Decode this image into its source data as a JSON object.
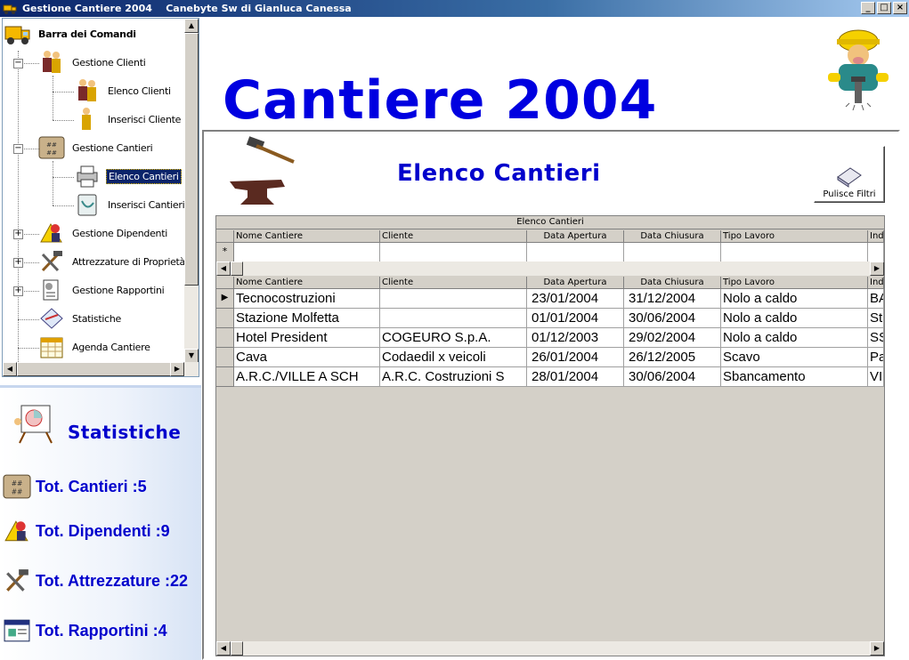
{
  "window": {
    "title": "Gestione Cantiere 2004    Canebyte Sw di Gianluca Canessa",
    "buttons": [
      "_",
      "□",
      "×"
    ]
  },
  "tree": {
    "root": "Barra dei Comandi",
    "items": [
      {
        "label": "Gestione Clienti",
        "expander": "−"
      },
      {
        "label": "Elenco Clienti"
      },
      {
        "label": "Inserisci Cliente"
      },
      {
        "label": "Gestione Cantieri",
        "expander": "−"
      },
      {
        "label": "Elenco Cantieri"
      },
      {
        "label": "Inserisci Cantieri"
      },
      {
        "label": "Gestione Dipendenti",
        "expander": "+"
      },
      {
        "label": "Attrezzature di Proprietà",
        "expander": "+"
      },
      {
        "label": "Gestione Rapportini",
        "expander": "+"
      },
      {
        "label": "Statistiche"
      },
      {
        "label": "Agenda Cantiere"
      }
    ]
  },
  "stats": {
    "title": "Statistiche",
    "cantieri": "Tot. Cantieri :5",
    "dipendenti": "Tot. Dipendenti :9",
    "attrezzature": "Tot. Attrezzature :22",
    "rapportini": "Tot. Rapportini :4"
  },
  "main": {
    "header": "Cantiere 2004",
    "form_title": "Elenco Cantieri",
    "clear_button": "Pulisce Filtri"
  },
  "grid": {
    "caption": "Elenco Cantieri",
    "columns": [
      "Nome Cantiere",
      "Cliente",
      "Data Apertura",
      "Data Chiusura",
      "Tipo Lavoro",
      "Indi"
    ],
    "new_row_marker": "*",
    "rows": [
      [
        "Tecnocostruzioni",
        "",
        "23/01/2004",
        "31/12/2004",
        "Nolo a caldo",
        "BA"
      ],
      [
        "Stazione Molfetta",
        "",
        "01/01/2004",
        "30/06/2004",
        "Nolo a caldo",
        "St"
      ],
      [
        "Hotel President",
        "COGEURO S.p.A.",
        "01/12/2003",
        "29/02/2004",
        "Nolo a caldo",
        "SS"
      ],
      [
        "Cava",
        "Codaedil x veicoli",
        "26/01/2004",
        "26/12/2005",
        "Scavo",
        "Pa"
      ],
      [
        "A.R.C./VILLE A SCH",
        "A.R.C. Costruzioni S",
        "28/01/2004",
        "30/06/2004",
        "Sbancamento",
        "VI."
      ]
    ]
  }
}
